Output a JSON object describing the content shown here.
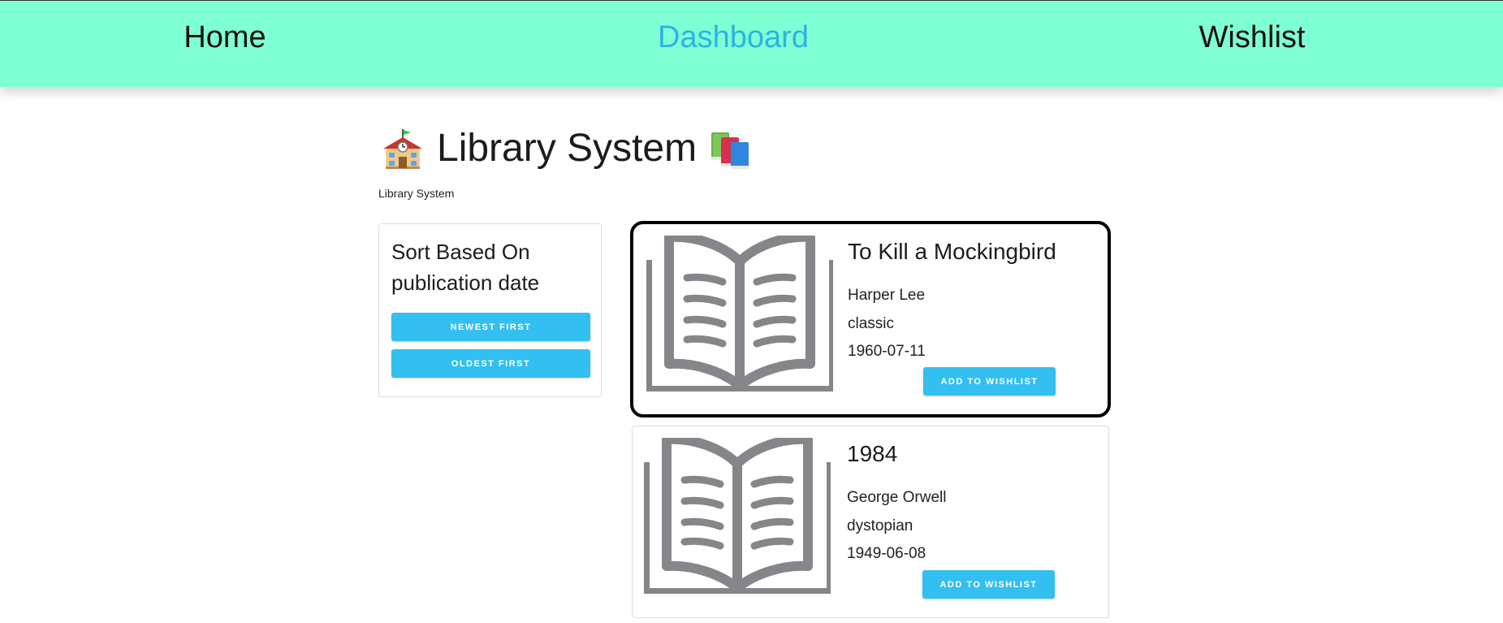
{
  "nav": {
    "home": "Home",
    "dashboard": "Dashboard",
    "wishlist": "Wishlist",
    "active": "dashboard"
  },
  "header": {
    "title": "Library System",
    "subtitle": "Library System",
    "left_icon": "school-building-icon",
    "right_icon": "books-icon"
  },
  "sort": {
    "heading": "Sort Based On publication date",
    "newest_label": "Newest first",
    "oldest_label": "Oldest first"
  },
  "books": [
    {
      "title": "To Kill a Mockingbird",
      "author": "Harper Lee",
      "genre": "classic",
      "date": "1960-07-11",
      "button": "Add to wishlist",
      "icon": "open-book-icon"
    },
    {
      "title": "1984",
      "author": "George Orwell",
      "genre": "dystopian",
      "date": "1949-06-08",
      "button": "Add to wishlist",
      "icon": "open-book-icon"
    }
  ],
  "colors": {
    "navbar_bg": "#7fffd4",
    "active_link": "#2bb3e3",
    "button_bg": "#33bff0",
    "book_icon": "#808080"
  }
}
